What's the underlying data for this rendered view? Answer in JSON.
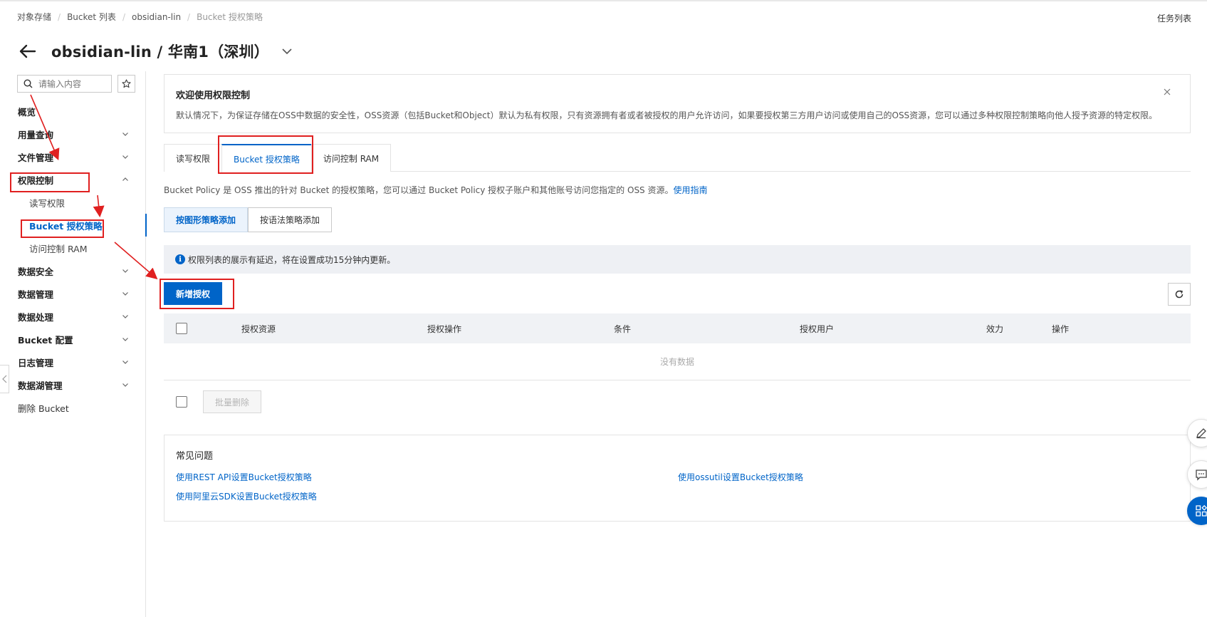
{
  "breadcrumb": {
    "items": [
      "对象存储",
      "Bucket 列表",
      "obsidian-lin"
    ],
    "current": "Bucket 授权策略"
  },
  "header": {
    "task_list": "任务列表",
    "title": "obsidian-lin / 华南1（深圳）"
  },
  "sidebar": {
    "search_placeholder": "请输入内容",
    "items": [
      {
        "label": "概览"
      },
      {
        "label": "用量查询"
      },
      {
        "label": "文件管理"
      },
      {
        "label": "权限控制"
      },
      {
        "label": "读写权限"
      },
      {
        "label": "Bucket 授权策略"
      },
      {
        "label": "访问控制 RAM"
      },
      {
        "label": "数据安全"
      },
      {
        "label": "数据管理"
      },
      {
        "label": "数据处理"
      },
      {
        "label": "Bucket 配置"
      },
      {
        "label": "日志管理"
      },
      {
        "label": "数据湖管理"
      },
      {
        "label": "删除 Bucket"
      }
    ]
  },
  "notice": {
    "title": "欢迎使用权限控制",
    "text": "默认情况下，为保证存储在OSS中数据的安全性，OSS资源（包括Bucket和Object）默认为私有权限，只有资源拥有者或者被授权的用户允许访问，如果要授权第三方用户访问或使用自己的OSS资源，您可以通过多种权限控制策略向他人授予资源的特定权限。"
  },
  "tabs": [
    "读写权限",
    "Bucket 授权策略",
    "访问控制 RAM"
  ],
  "policy": {
    "description": "Bucket Policy 是 OSS 推出的针对 Bucket 的授权策略，您可以通过 Bucket Policy 授权子账户和其他账号访问您指定的 OSS 资源。",
    "guide_link": "使用指南"
  },
  "segmented": [
    "按图形策略添加",
    "按语法策略添加"
  ],
  "info": {
    "icon": "i",
    "text": "权限列表的展示有延迟，将在设置成功15分钟内更新。"
  },
  "actions": {
    "add": "新增授权",
    "batch_delete": "批量删除"
  },
  "table": {
    "columns": [
      "授权资源",
      "授权操作",
      "条件",
      "授权用户",
      "效力",
      "操作"
    ],
    "empty": "没有数据"
  },
  "faq": {
    "title": "常见问题",
    "links": [
      "使用REST API设置Bucket授权策略",
      "使用ossutil设置Bucket授权策略",
      "使用阿里云SDK设置Bucket授权策略"
    ]
  },
  "colors": {
    "primary": "#0064c8",
    "annotation": "#e02020"
  }
}
